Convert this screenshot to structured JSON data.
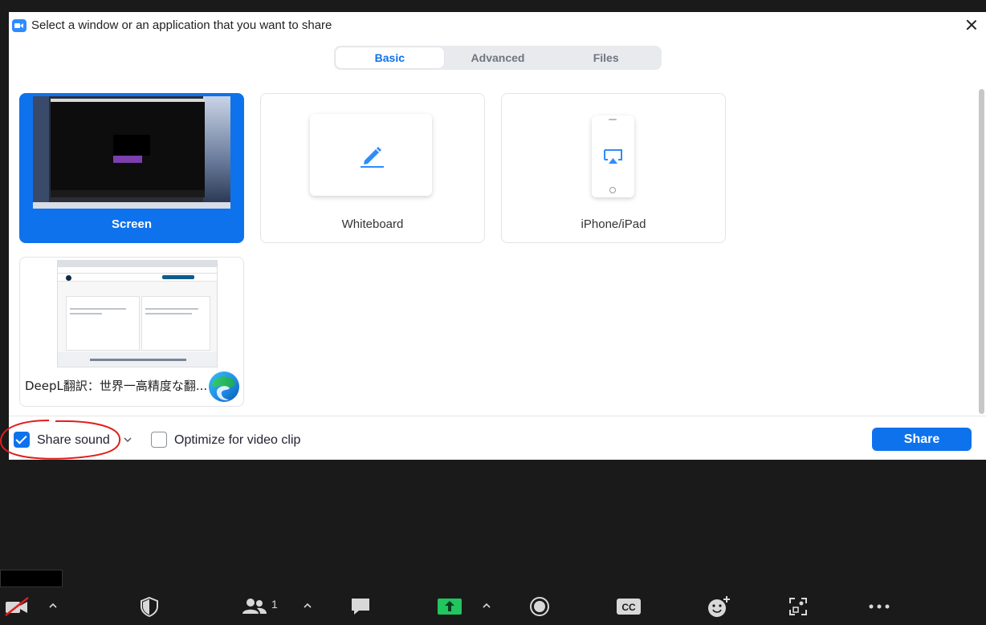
{
  "dialog": {
    "title": "Select a window or an application that you want to share"
  },
  "tabs": [
    {
      "label": "Basic",
      "active": true
    },
    {
      "label": "Advanced",
      "active": false
    },
    {
      "label": "Files",
      "active": false
    }
  ],
  "tiles": {
    "screen": {
      "label": "Screen",
      "selected": true
    },
    "whiteboard": {
      "label": "Whiteboard"
    },
    "iphone": {
      "label": "iPhone/iPad"
    },
    "app_window": {
      "label": "DeepL翻訳：世界一高精度な翻..."
    }
  },
  "options": {
    "share_sound": {
      "label": "Share sound",
      "checked": true
    },
    "optimize_video": {
      "label": "Optimize for video clip",
      "checked": false
    }
  },
  "share_button": {
    "label": "Share"
  },
  "meeting_toolbar": {
    "participants_count": "1",
    "icons": [
      "video-off-icon",
      "security-icon",
      "participants-icon",
      "chat-icon",
      "share-screen-icon",
      "record-icon",
      "closed-caption-icon",
      "reactions-icon",
      "apps-icon",
      "more-icon"
    ],
    "cc_label": "CC"
  },
  "colors": {
    "accent": "#0e72ed",
    "share_green": "#22c55e",
    "annotation_red": "#e11d1d"
  }
}
